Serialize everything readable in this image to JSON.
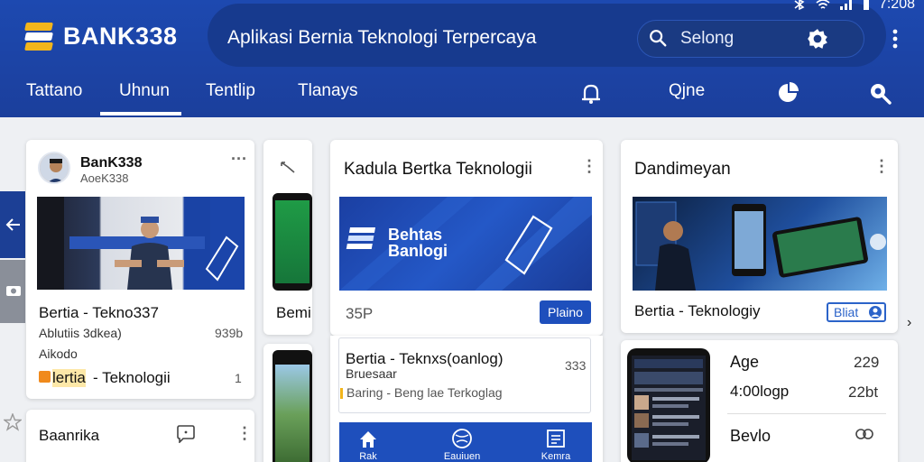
{
  "app": {
    "logo_text": "BANK338",
    "title": "Aplikasi Bernia Teknologi Terpercaya"
  },
  "status_bar": {
    "time": "7:208"
  },
  "search": {
    "placeholder": "Selong"
  },
  "tabs": [
    {
      "label": "Tattano"
    },
    {
      "label": "Uhnun"
    },
    {
      "label": "Tentlip"
    },
    {
      "label": "Tlanays"
    }
  ],
  "tab_right": {
    "label": "Qjne"
  },
  "card1": {
    "name": "BanK338",
    "handle": "AoeK338",
    "title": "Bertia - Tekno337",
    "line1": "Ablutiis 3dkea)",
    "line1_num": "939b",
    "line2": "Aikodo",
    "tag_part1": "lertia",
    "tag_part2": "- Teknologii",
    "tag_num": "1"
  },
  "card_small": {
    "label": "Bemi"
  },
  "card2": {
    "title": "Kadula Bertka Teknologii",
    "banner_text_1": "Behtas",
    "banner_text_2": "Banlogi",
    "num": "35P",
    "button": "Plaino"
  },
  "card3": {
    "title": "Bertia - Teknxs(oanlog)",
    "sub": "Bruesaar",
    "num": "333",
    "line": "Baring - Beng lae Terkoglag"
  },
  "bottom_bar": [
    {
      "label": "Rak"
    },
    {
      "label": "Eauiuen"
    },
    {
      "label": "Kemra"
    }
  ],
  "card4": {
    "title": "Dandimeyan",
    "subtitle": "Bertia - Teknologiy",
    "button": "Bliat"
  },
  "card5": {
    "row1_label": "Age",
    "row1_num": "229",
    "row2_label": "4:00logp",
    "row2_num": "22bt",
    "row3_label": "Bevlo"
  },
  "card6": {
    "title": "Baanrika"
  }
}
